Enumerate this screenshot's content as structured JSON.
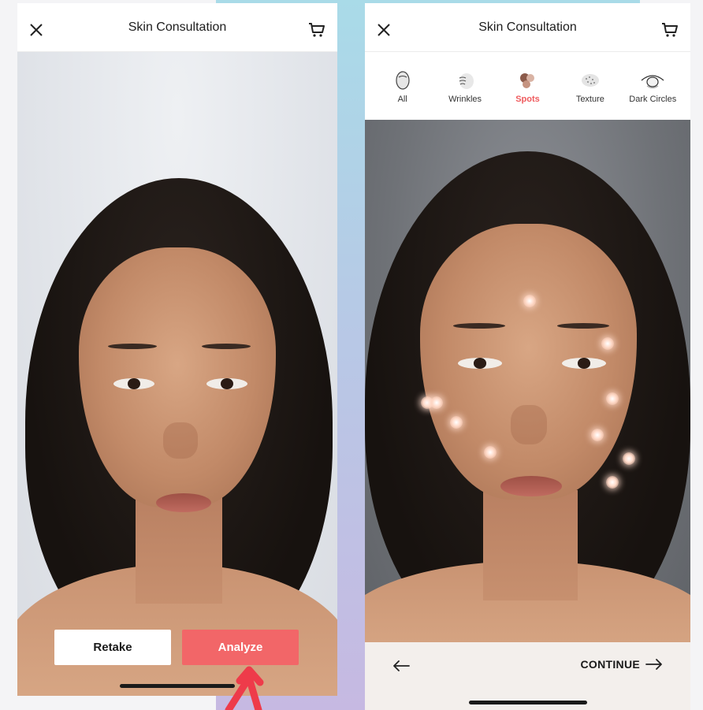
{
  "left_screen": {
    "header": {
      "title": "Skin Consultation",
      "close_icon": "close-icon",
      "cart_icon": "cart-icon"
    },
    "buttons": {
      "retake": "Retake",
      "analyze": "Analyze"
    },
    "colors": {
      "analyze": "#f26668"
    }
  },
  "right_screen": {
    "header": {
      "title": "Skin Consultation",
      "close_icon": "close-icon",
      "cart_icon": "cart-icon"
    },
    "tabs": [
      {
        "label": "All",
        "icon": "face-outline-icon",
        "active": false
      },
      {
        "label": "Wrinkles",
        "icon": "wrinkles-icon",
        "active": false
      },
      {
        "label": "Spots",
        "icon": "spots-icon",
        "active": true
      },
      {
        "label": "Texture",
        "icon": "texture-icon",
        "active": false
      },
      {
        "label": "Dark Circles",
        "icon": "eye-icon",
        "active": false
      }
    ],
    "footer": {
      "continue": "CONTINUE",
      "back_icon": "arrow-left-icon",
      "forward_icon": "arrow-right-icon"
    },
    "colors": {
      "active_tab": "#ef5b5e"
    }
  },
  "annotation": {
    "pointer_icon": "pointer-arrow-icon",
    "color": "#ee3b4a"
  }
}
